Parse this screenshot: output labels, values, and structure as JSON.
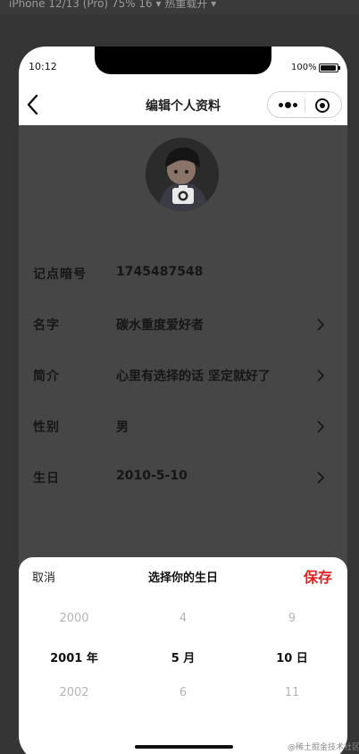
{
  "simulator_bar": {
    "text": "iPhone 12/13 (Pro) 75% 16 ▾     热重载开 ▾"
  },
  "status_bar": {
    "time": "10:12",
    "battery_percent": "100%"
  },
  "navbar": {
    "title": "编辑个人资料"
  },
  "profile": {
    "rows": [
      {
        "label": "记点暗号",
        "value": "1745487548",
        "has_arrow": false
      },
      {
        "label": "名字",
        "value": "碳水重度爱好者",
        "has_arrow": true
      },
      {
        "label": "简介",
        "value": "心里有选择的话 坚定就好了",
        "has_arrow": true
      },
      {
        "label": "性别",
        "value": "男",
        "has_arrow": true
      },
      {
        "label": "生日",
        "value": "2010-5-10",
        "has_arrow": true
      }
    ]
  },
  "date_picker": {
    "cancel_label": "取消",
    "title": "选择你的生日",
    "save_label": "保存",
    "save_color": "#e02020",
    "year": {
      "prev": "2000",
      "selected": "2001 年",
      "next": "2002"
    },
    "month": {
      "prev": "4",
      "selected": "5 月",
      "next": "6"
    },
    "day": {
      "prev": "9",
      "selected": "10 日",
      "next": "11"
    }
  },
  "watermark": "@稀土掘金技术社区"
}
